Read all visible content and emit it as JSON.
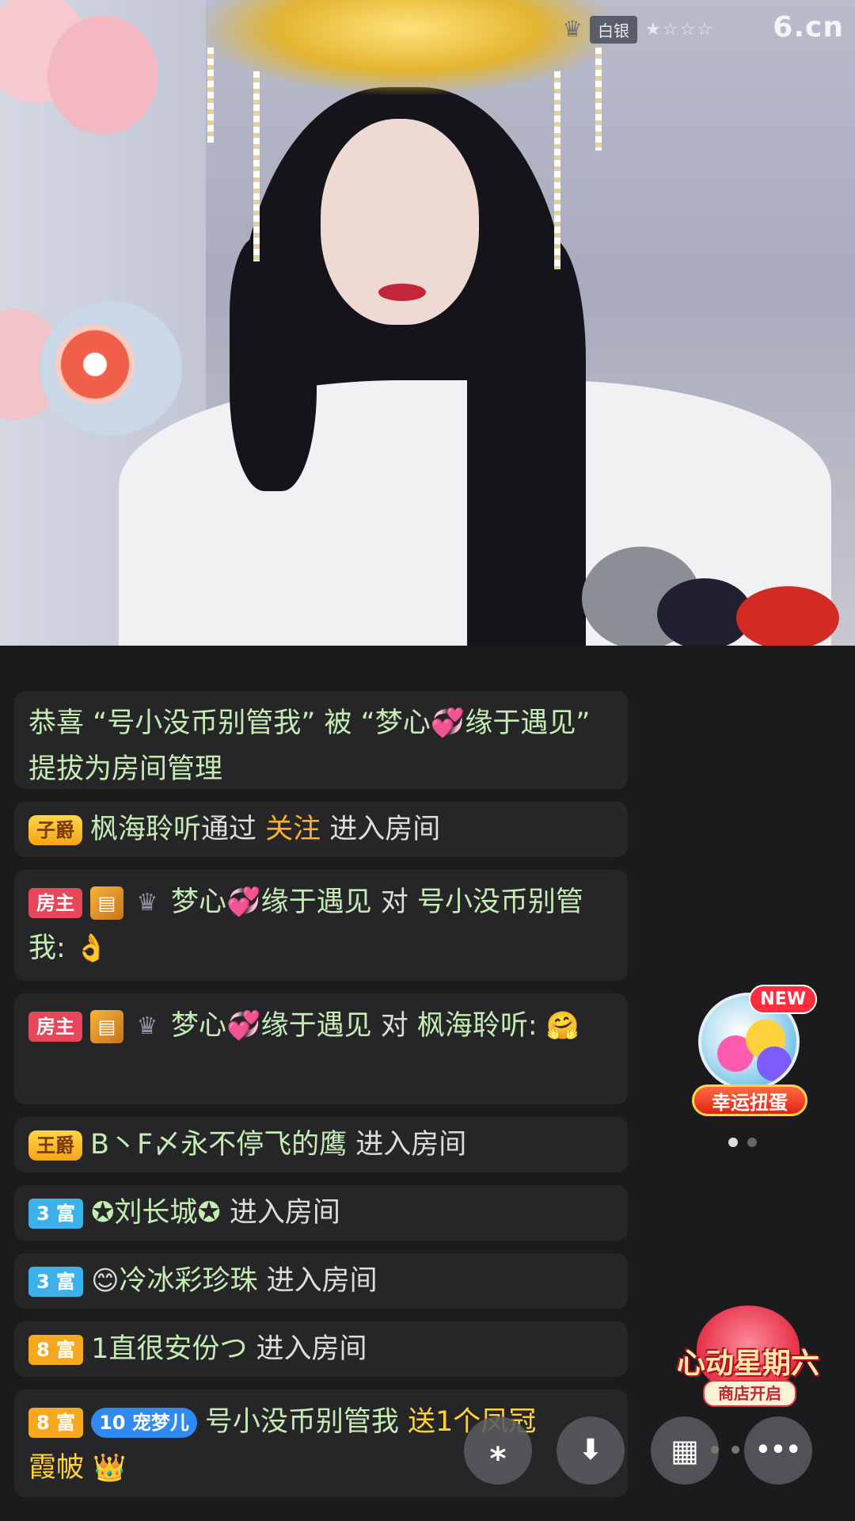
{
  "stream": {
    "rank_label": "白银",
    "rank_stars": "★☆☆☆",
    "site_logo": "6.cn"
  },
  "chat": [
    {
      "type": "system",
      "text_a": "恭喜 “号小没币别管我” 被 “梦心",
      "heart": "💞",
      "text_b": "缘于遇见” 提拔为房间管理"
    },
    {
      "type": "enter",
      "badge": "子爵",
      "user": "枫海聆听",
      "via": "通过 ",
      "action": "关注",
      "suffix": " 进入房间"
    },
    {
      "type": "chat",
      "badge": "房主",
      "sender_a": "梦心",
      "heart": "💞",
      "sender_b": "缘于遇见",
      "to_word": " 对 ",
      "target": "号小没币别管我:",
      "emoji": "👌"
    },
    {
      "type": "chat",
      "badge": "房主",
      "sender_a": "梦心",
      "heart": "💞",
      "sender_b": "缘于遇见",
      "to_word": " 对 ",
      "target": "枫海聆听:",
      "emoji": "🤗"
    },
    {
      "type": "enter",
      "badge": "王爵",
      "user": "B丶F〆永不停飞的鹰",
      "suffix": " 进入房间"
    },
    {
      "type": "enter",
      "badge": "3 富",
      "user": "✪刘长城✪",
      "suffix": " 进入房间"
    },
    {
      "type": "enter",
      "badge": "3 富",
      "user_emoji": "😊",
      "user": "冷冰彩珍珠",
      "suffix": " 进入房间"
    },
    {
      "type": "enter",
      "badge": "8 富",
      "user": "1直很安份つ",
      "suffix": " 进入房间"
    },
    {
      "type": "gift",
      "badge": "8 富",
      "pet_level": "10",
      "pet_name": "宠梦儿",
      "user": "号小没币别管我 ",
      "gift_text": "送1个凤冠",
      "gift_text_2": "霞帔"
    }
  ],
  "widgets": {
    "egg_new": "NEW",
    "egg_label": "幸运扭蛋",
    "promo_title": "心动星期六",
    "promo_sub": "商店开启"
  },
  "toolbar": {
    "share_icon": "⁎",
    "download_icon": "⬇",
    "grid_icon": "▦",
    "more_icon": "•••"
  }
}
